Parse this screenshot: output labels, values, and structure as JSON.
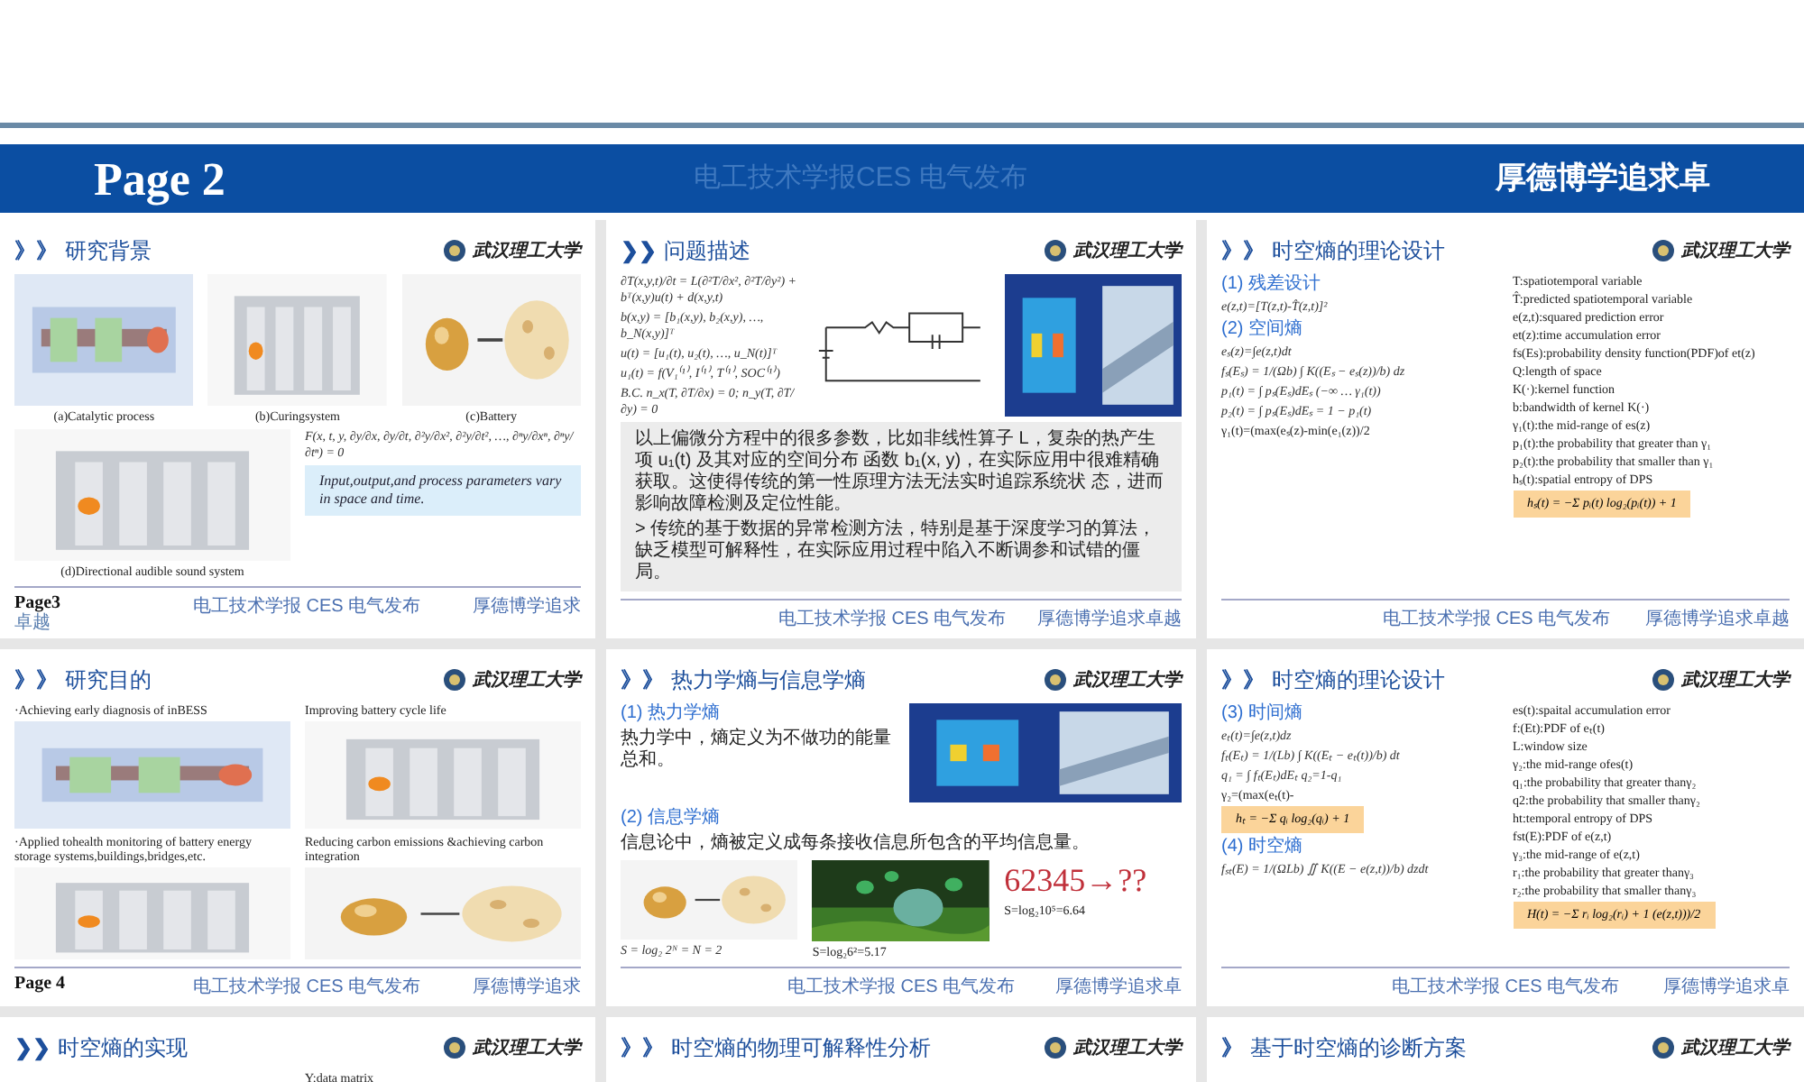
{
  "banner": {
    "page": "Page 2",
    "center": "电工技术学报CES  电气发布",
    "right": "厚德博学追求卓"
  },
  "slides": [
    {
      "marker": "》》",
      "title": "研究背景",
      "logo": "武汉理工大学",
      "rows": [
        [
          [
            {
              "kind": "picture"
            },
            {
              "kind": "caption",
              "text": "(a)Catalytic process"
            }
          ],
          [
            {
              "kind": "picture"
            },
            {
              "kind": "caption",
              "text": "(b)Curingsystem"
            }
          ],
          [
            {
              "kind": "picture"
            },
            {
              "kind": "caption",
              "text": "(c)Battery"
            }
          ]
        ],
        [
          [
            {
              "kind": "picture"
            },
            {
              "kind": "caption",
              "text": "(d)Directional audible sound system"
            }
          ],
          [
            {
              "kind": "formula",
              "text": "F(x, t, y, ∂y/∂x, ∂y/∂t, ∂²y/∂x², ∂²y/∂t², …, ∂ⁿy/∂xⁿ, ∂ⁿy/∂tⁿ) = 0"
            },
            {
              "kind": "note",
              "text": "Input,output,and process parameters vary in space and time."
            }
          ]
        ]
      ],
      "footer": {
        "page": "Page3",
        "page_sub": "卓越",
        "center": "电工技术学报 CES 电气发布",
        "right": "厚德博学追求"
      }
    },
    {
      "marker": "❯❯",
      "title": "问题描述",
      "logo": "武汉理工大学",
      "rows": [
        [
          [
            {
              "kind": "formula",
              "text": "∂T(x,y,t)/∂t = L(∂²T/∂x², ∂²T/∂y²) + bᵀ(x,y)u(t) + d(x,y,t)"
            },
            {
              "kind": "formula",
              "text": "b(x,y) = [b₁(x,y), b₂(x,y), …, b_N(x,y)]ᵀ"
            },
            {
              "kind": "formula",
              "text": "u(t) = [u₁(t), u₂(t), …, u_N(t)]ᵀ"
            },
            {
              "kind": "formula",
              "text": "u₁(t) = f(V₁⁽¹⁾, I⁽¹⁾, T⁽¹⁾, SOC⁽¹⁾)"
            },
            {
              "kind": "formula",
              "text": "B.C. n_x(T, ∂T/∂x) = 0;  n_y(T, ∂T/∂y) = 0"
            }
          ],
          [
            {
              "kind": "diagram"
            }
          ],
          [
            {
              "kind": "picture"
            }
          ]
        ],
        [
          [
            {
              "kind": "panel",
              "paragraphs": [
                "以上偏微分方程中的很多参数，比如非线性算子 L，复杂的热产生项 u₁(t) 及其对应的空间分布 函数 b₁(x, y)，在实际应用中很难精确获取。这使得传统的第一性原理方法无法实时追踪系统状 态，进而影响故障检测及定位性能。",
                "> 传统的基于数据的异常检测方法，特别是基于深度学习的算法，缺乏模型可解释性，在实际应用过程中陷入不断调参和试错的僵局。"
              ]
            }
          ]
        ]
      ],
      "footer": {
        "center": "电工技术学报 CES 电气发布",
        "right": "厚德博学追求卓越"
      }
    },
    {
      "marker": "》》",
      "title": "时空熵的理论设计",
      "logo": "武汉理工大学",
      "rows": [
        [
          [
            {
              "kind": "heading",
              "text": "(1) 残差设计"
            },
            {
              "kind": "formula",
              "text": "e(z,t)=[T(z,t)-T̂(z,t)]²"
            },
            {
              "kind": "heading",
              "text": "(2) 空间熵"
            },
            {
              "kind": "formula",
              "text": "eₛ(z)=∫e(z,t)dt"
            },
            {
              "kind": "formula",
              "text": "fₛ(Eₛ) = 1/(Ωb) ∫ K((Eₛ − eₛ(z))/b) dz"
            },
            {
              "kind": "formula",
              "text": "p₁(t) = ∫ pₛ(Eₛ)dEₛ  (−∞ … γ₁(t))"
            },
            {
              "kind": "formula",
              "text": "p₂(t) = ∫ pₛ(Eₛ)dEₛ = 1 − p₁(t)"
            },
            {
              "kind": "text",
              "text": "γ₁(t)=(max(eₛ(z)-min(e₁(z))/2"
            }
          ],
          [
            {
              "kind": "text",
              "text": "T:spatiotemporal variable"
            },
            {
              "kind": "text",
              "text": "T̂:predicted spatiotemporal variable"
            },
            {
              "kind": "text",
              "text": "e(z,t):squared prediction error"
            },
            {
              "kind": "text",
              "text": "et(z):time accumulation error"
            },
            {
              "kind": "text",
              "text": "fs(Es):probability density function(PDF)of et(z)"
            },
            {
              "kind": "text",
              "text": "Q:length of space"
            },
            {
              "kind": "text",
              "text": "K(·):kernel function"
            },
            {
              "kind": "text",
              "text": "b:bandwidth of kernel K(·)"
            },
            {
              "kind": "text",
              "text": "γ₁(t):the mid-range of es(z)"
            },
            {
              "kind": "text",
              "text": "p₁(t):the probability that greater than γ₁"
            },
            {
              "kind": "text",
              "text": "p₂(t):the probability that smaller than γ₁"
            },
            {
              "kind": "text",
              "text": "hₛ(t):spatial entropy of DPS"
            },
            {
              "kind": "formula-box",
              "text": "hₛ(t) = −Σ pᵢ(t) log₂(pᵢ(t)) + 1"
            }
          ]
        ]
      ],
      "footer": {
        "center": "电工技术学报 CES 电气发布",
        "right": "厚德博学追求卓越"
      }
    },
    {
      "marker": "》》",
      "title": "研究目的",
      "logo": "武汉理工大学",
      "rows": [
        [
          [
            {
              "kind": "text",
              "text": "·Achieving early diagnosis of inBESS"
            },
            {
              "kind": "picture"
            }
          ],
          [
            {
              "kind": "text",
              "text": "Improving battery cycle life"
            },
            {
              "kind": "picture"
            }
          ]
        ],
        [
          [
            {
              "kind": "text",
              "text": "·Applied tohealth monitoring of battery energy storage systems,buildings,bridges,etc."
            },
            {
              "kind": "picture"
            }
          ],
          [
            {
              "kind": "text",
              "text": "Reducing carbon emissions &achieving carbon integration"
            },
            {
              "kind": "picture"
            }
          ]
        ]
      ],
      "footer": {
        "page": "Page 4",
        "center": "电工技术学报 CES 电气发布",
        "right": "厚德博学追求"
      }
    },
    {
      "marker": "》》",
      "title": "热力学熵与信息学熵",
      "logo": "武汉理工大学",
      "rows": [
        [
          [
            {
              "kind": "heading",
              "text": "(1) 热力学熵"
            },
            {
              "kind": "paragraph",
              "text": "热力学中，熵定义为不做功的能量总和。"
            }
          ],
          [
            {
              "kind": "picture"
            }
          ]
        ],
        [
          [
            {
              "kind": "heading",
              "text": "(2) 信息学熵"
            },
            {
              "kind": "paragraph",
              "text": "信息论中，熵被定义成每条接收信息所包含的平均信息量。"
            }
          ]
        ],
        [
          [
            {
              "kind": "picture"
            },
            {
              "kind": "formula",
              "text": "S = log₂ 2ᴺ = N = 2"
            }
          ],
          [
            {
              "kind": "picture"
            },
            {
              "kind": "text",
              "text": "S=log₂6²=5.17"
            }
          ],
          [
            {
              "kind": "big-number",
              "text": "62345→??"
            },
            {
              "kind": "text",
              "text": "S=log₂10⁵=6.64"
            }
          ]
        ]
      ],
      "footer": {
        "center": "电工技术学报 CES 电气发布",
        "right": "厚德博学追求卓"
      }
    },
    {
      "marker": "》》",
      "title": "时空熵的理论设计",
      "logo": "武汉理工大学",
      "rows": [
        [
          [
            {
              "kind": "heading",
              "text": "(3) 时间熵"
            },
            {
              "kind": "formula",
              "text": "eₜ(t)=∫e(z,t)dz"
            },
            {
              "kind": "formula",
              "text": "fₜ(Eₜ) = 1/(Lb) ∫ K((Eₜ − eₜ(t))/b) dt"
            },
            {
              "kind": "formula",
              "text": "q₁ = ∫ fₜ(Eₜ)dEₜ   q₂=1-q₁"
            },
            {
              "kind": "text",
              "text": "γ₂=(max(eₜ(t)-"
            },
            {
              "kind": "formula-box",
              "text": "hₜ = −Σ qᵢ log₂(qᵢ) + 1"
            },
            {
              "kind": "heading",
              "text": "(4) 时空熵"
            },
            {
              "kind": "formula",
              "text": "fₛₜ(E) = 1/(ΩLb) ∬ K((E − e(z,t))/b) dzdt"
            }
          ],
          [
            {
              "kind": "text",
              "text": "es(t):spaital accumulation error"
            },
            {
              "kind": "text",
              "text": "f:(Et):PDF of eₜ(t)"
            },
            {
              "kind": "text",
              "text": "L:window size"
            },
            {
              "kind": "text",
              "text": "γ₂:the mid-range ofes(t)"
            },
            {
              "kind": "text",
              "text": "q₁:the probability that greater thanγ₂"
            },
            {
              "kind": "text",
              "text": "q2:the probability that smaller thanγ₂"
            },
            {
              "kind": "text",
              "text": "ht:temporal entropy of DPS"
            },
            {
              "kind": "text",
              "text": "fst(E):PDF of e(z,t)"
            },
            {
              "kind": "text",
              "text": "γ₃:the mid-range of e(z,t)"
            },
            {
              "kind": "text",
              "text": "r₁:the probability that greater thanγ₃"
            },
            {
              "kind": "text",
              "text": "r₂:the probability that smaller thanγ₃"
            },
            {
              "kind": "formula-box",
              "text": "H(t) = −Σ rᵢ log₂(rᵢ) + 1   (e(z,t)))/2"
            }
          ]
        ]
      ],
      "footer": {
        "center": "电工技术学报 CES 电气发布",
        "right": "厚德博学追求卓"
      }
    },
    {
      "marker": "❯❯",
      "title": "时空熵的实现",
      "logo": "武汉理工大学",
      "rows": [
        [
          [],
          [
            {
              "kind": "text",
              "text": "Y:data matrix"
            }
          ]
        ]
      ]
    },
    {
      "marker": "》》",
      "title": "时空熵的物理可解释性分析",
      "logo": "武汉理工大学"
    },
    {
      "marker": "》",
      "title": "基于时空熵的诊断方案",
      "logo": "武汉理工大学"
    }
  ]
}
